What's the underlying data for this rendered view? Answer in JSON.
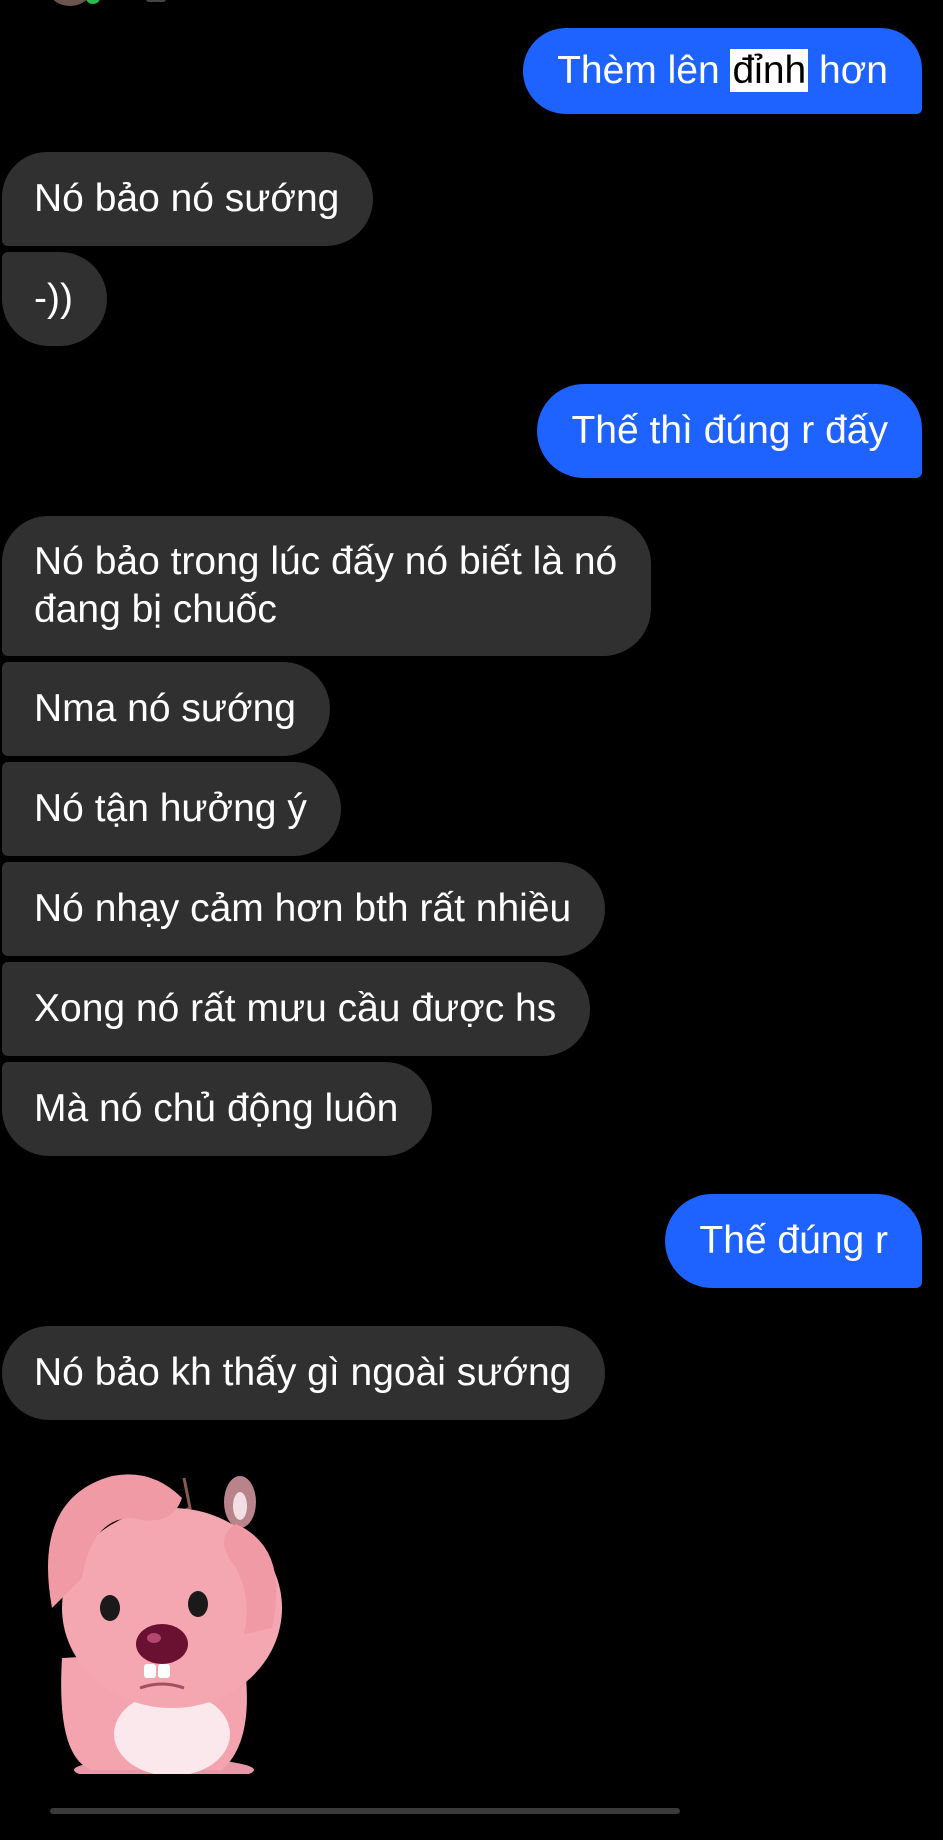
{
  "messages": [
    {
      "side": "out",
      "parts": [
        "Thèm lên ",
        "đỉnh",
        " hơn"
      ]
    },
    {
      "side": "in",
      "text": "Nó bảo nó sướng"
    },
    {
      "side": "in",
      "text": "-))"
    },
    {
      "side": "out",
      "text": "Thế thì đúng r đấy"
    },
    {
      "side": "in",
      "text": "Nó bảo trong lúc đấy nó biết là nó đang bị chuốc"
    },
    {
      "side": "in",
      "text": "Nma nó sướng"
    },
    {
      "side": "in",
      "text": "Nó tận hưởng ý"
    },
    {
      "side": "in",
      "text": "Nó nhạy cảm hơn bth rất nhiều"
    },
    {
      "side": "in",
      "text": "Xong nó rất mưu cầu được hs"
    },
    {
      "side": "in",
      "text": "Mà nó chủ động luôn"
    },
    {
      "side": "out",
      "text": "Thế đúng r"
    },
    {
      "side": "in",
      "text": "Nó bảo kh thấy gì ngoài sướng"
    }
  ],
  "message_lines": {
    "m4_line1": "Nó bảo trong lúc đấy nó biết là nó",
    "m4_line2": "đang bị chuốc"
  },
  "sticker": {
    "icon": "pink-beaver-sticker"
  },
  "colors": {
    "background": "#000000",
    "incoming": "#303030",
    "outgoing": "#1e63ff",
    "text": "#ffffff"
  }
}
